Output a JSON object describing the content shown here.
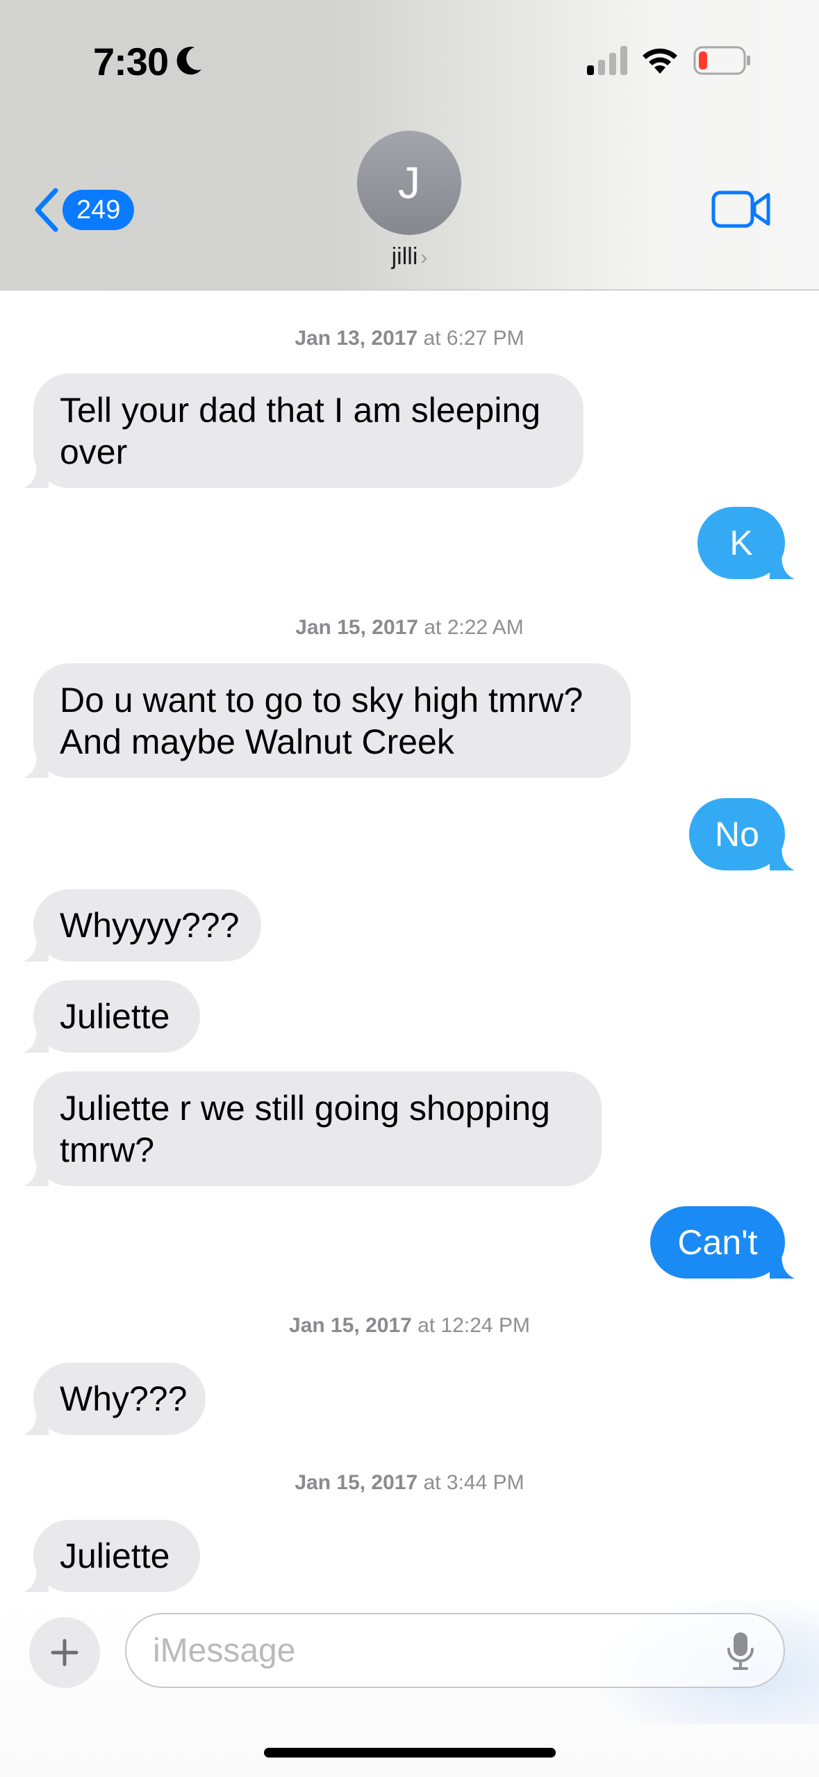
{
  "status_bar": {
    "time": "7:30",
    "icons": [
      "moon-icon",
      "cellular-signal-icon",
      "wifi-icon",
      "battery-low-icon"
    ],
    "battery_color": "#ff3b30"
  },
  "header": {
    "back_count": "249",
    "avatar_initial": "J",
    "contact_name": "jilli",
    "contact_chevron": "›",
    "video_icon": "video-camera-icon",
    "accent_color": "#0a7aff"
  },
  "conversation": {
    "ts1": {
      "date": "Jan 13, 2017",
      "at": "at",
      "time": "6:27 PM"
    },
    "m1": "Tell your dad that I am sleeping over",
    "m2": "K",
    "ts2": {
      "date": "Jan 15, 2017",
      "at": "at",
      "time": "2:22 AM"
    },
    "m3": "Do u want to go to sky high tmrw? And maybe Walnut Creek",
    "m4": "No",
    "m5": "Whyyyy???",
    "m6": "Juliette",
    "m7": "Juliette r we still going shopping tmrw?",
    "m8": "Can't",
    "ts3": {
      "date": "Jan 15, 2017",
      "at": "at",
      "time": "12:24 PM"
    },
    "m9": "Why???",
    "ts4": {
      "date": "Jan 15, 2017",
      "at": "at",
      "time": "3:44 PM"
    },
    "m10": "Juliette",
    "incoming_color": "#e9e9eb",
    "sms_color": "#34aaf4",
    "imessage_color": "#1a8af4"
  },
  "composer": {
    "placeholder": "iMessage",
    "plus_icon": "plus-icon",
    "mic_icon": "microphone-icon"
  }
}
